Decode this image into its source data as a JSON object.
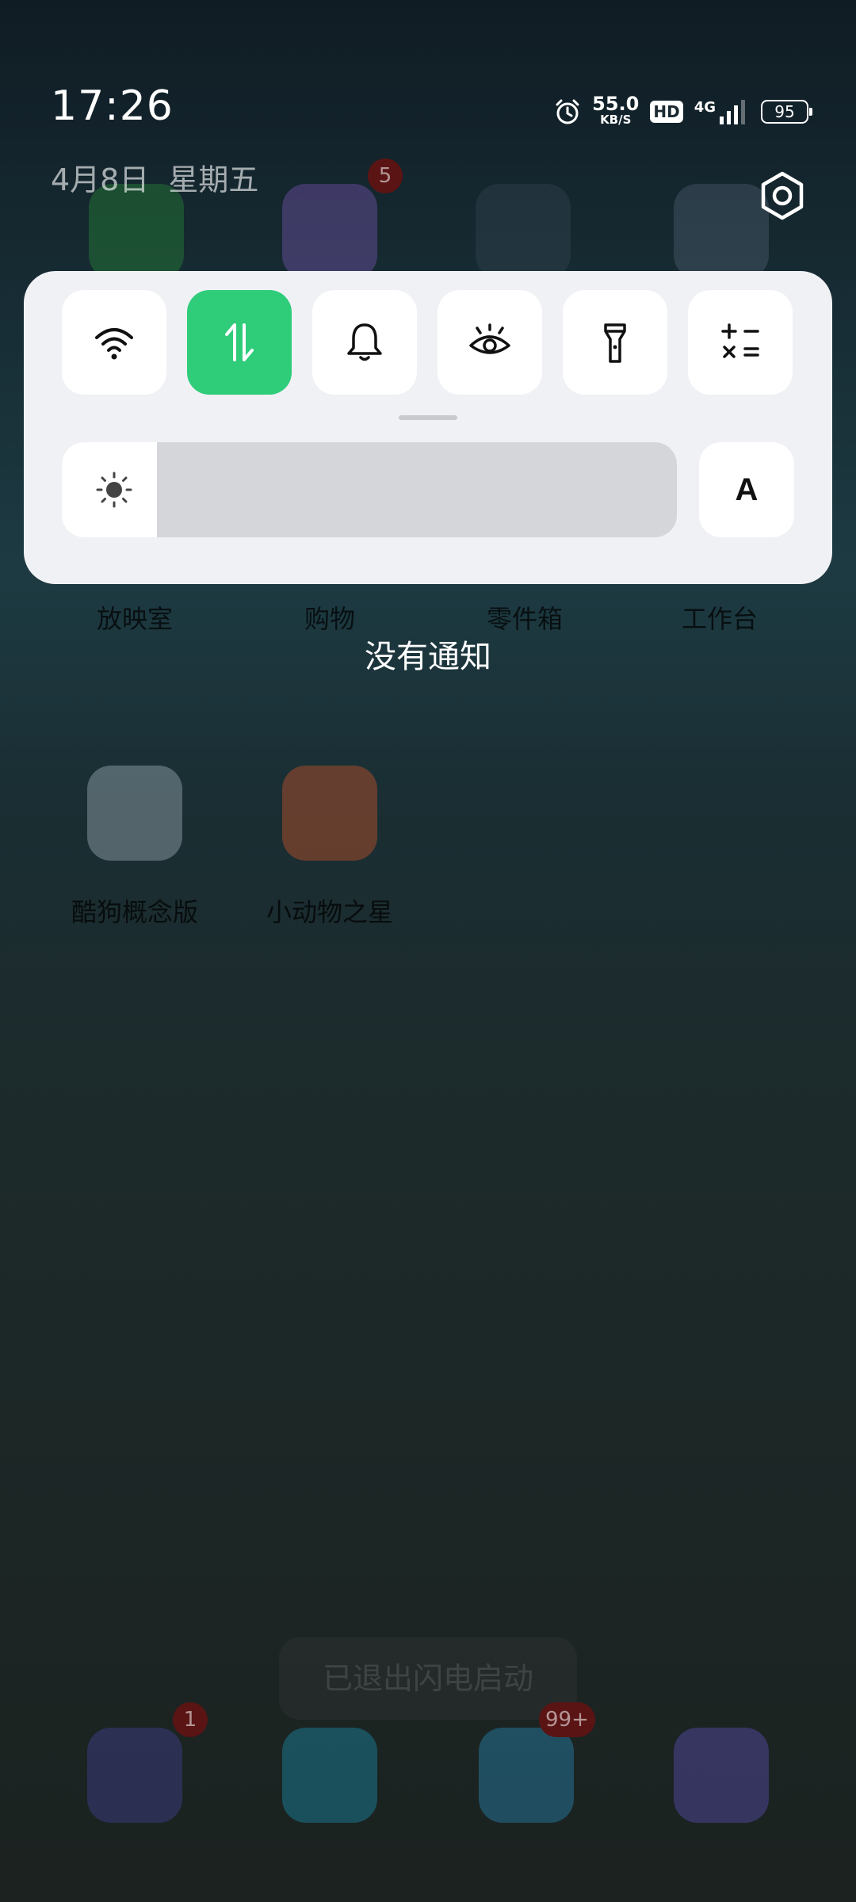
{
  "status_bar": {
    "time": "17:26",
    "date": "4月8日",
    "weekday": "星期五",
    "net_speed": "55.0",
    "net_speed_unit": "KB/S",
    "hd": "HD",
    "network": "4G",
    "battery": "95"
  },
  "quick_settings": {
    "tiles": [
      {
        "name": "wifi",
        "icon": "wifi-icon",
        "active": false
      },
      {
        "name": "mobile-data",
        "icon": "mobile-data-icon",
        "active": true
      },
      {
        "name": "sound",
        "icon": "bell-icon",
        "active": false
      },
      {
        "name": "eye-comfort",
        "icon": "eye-icon",
        "active": false
      },
      {
        "name": "flashlight",
        "icon": "flashlight-icon",
        "active": false
      },
      {
        "name": "calculator",
        "icon": "calculator-icon",
        "active": false
      }
    ],
    "brightness_level": 0.155,
    "auto_brightness_label": "A",
    "accent_color": "#2fcc7a"
  },
  "notifications": {
    "empty_text": "没有通知"
  },
  "home_screen": {
    "row1_labels": [
      "放映室",
      "购物",
      "零件箱",
      "工作台"
    ],
    "apps": [
      "酷狗概念版",
      "小动物之星"
    ],
    "badges": {
      "shopping": "5",
      "phone": "1",
      "messages": "99+"
    },
    "toast": "已退出闪电启动"
  }
}
